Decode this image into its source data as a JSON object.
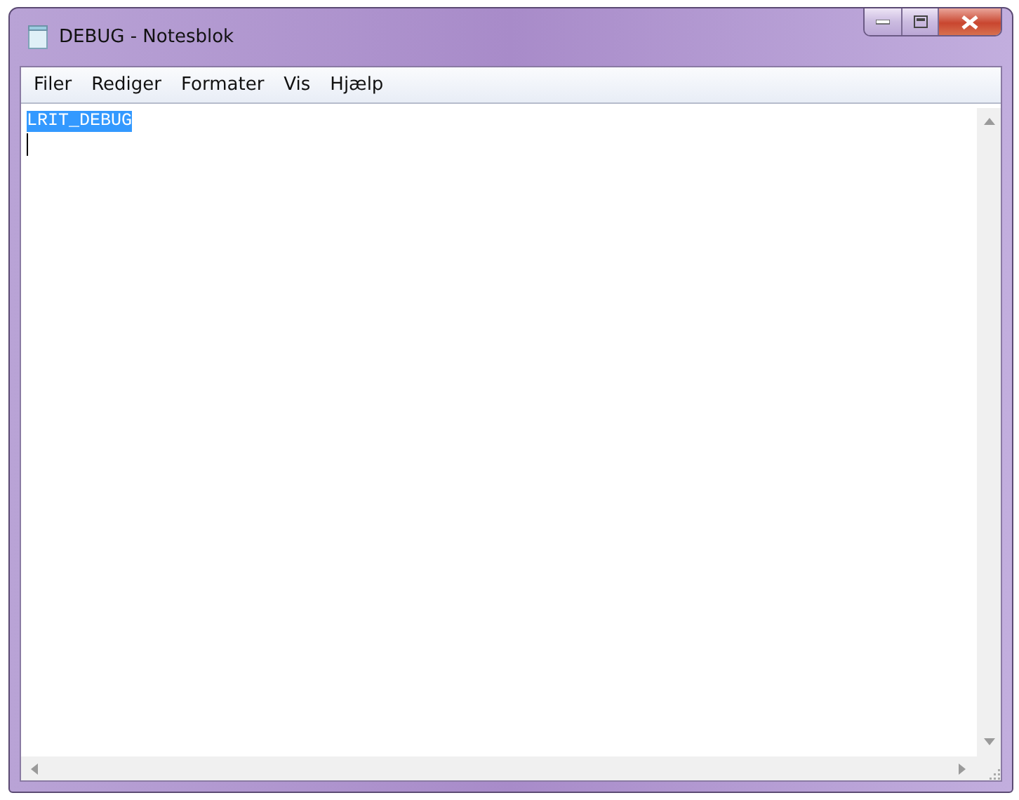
{
  "window": {
    "title": "DEBUG - Notesblok"
  },
  "menu": [
    {
      "label": "Filer"
    },
    {
      "label": "Rediger"
    },
    {
      "label": "Formater"
    },
    {
      "label": "Vis"
    },
    {
      "label": "Hjælp"
    }
  ],
  "document": {
    "lines": [
      {
        "text": "LRIT_DEBUG",
        "selected": true
      }
    ],
    "caret": true
  }
}
